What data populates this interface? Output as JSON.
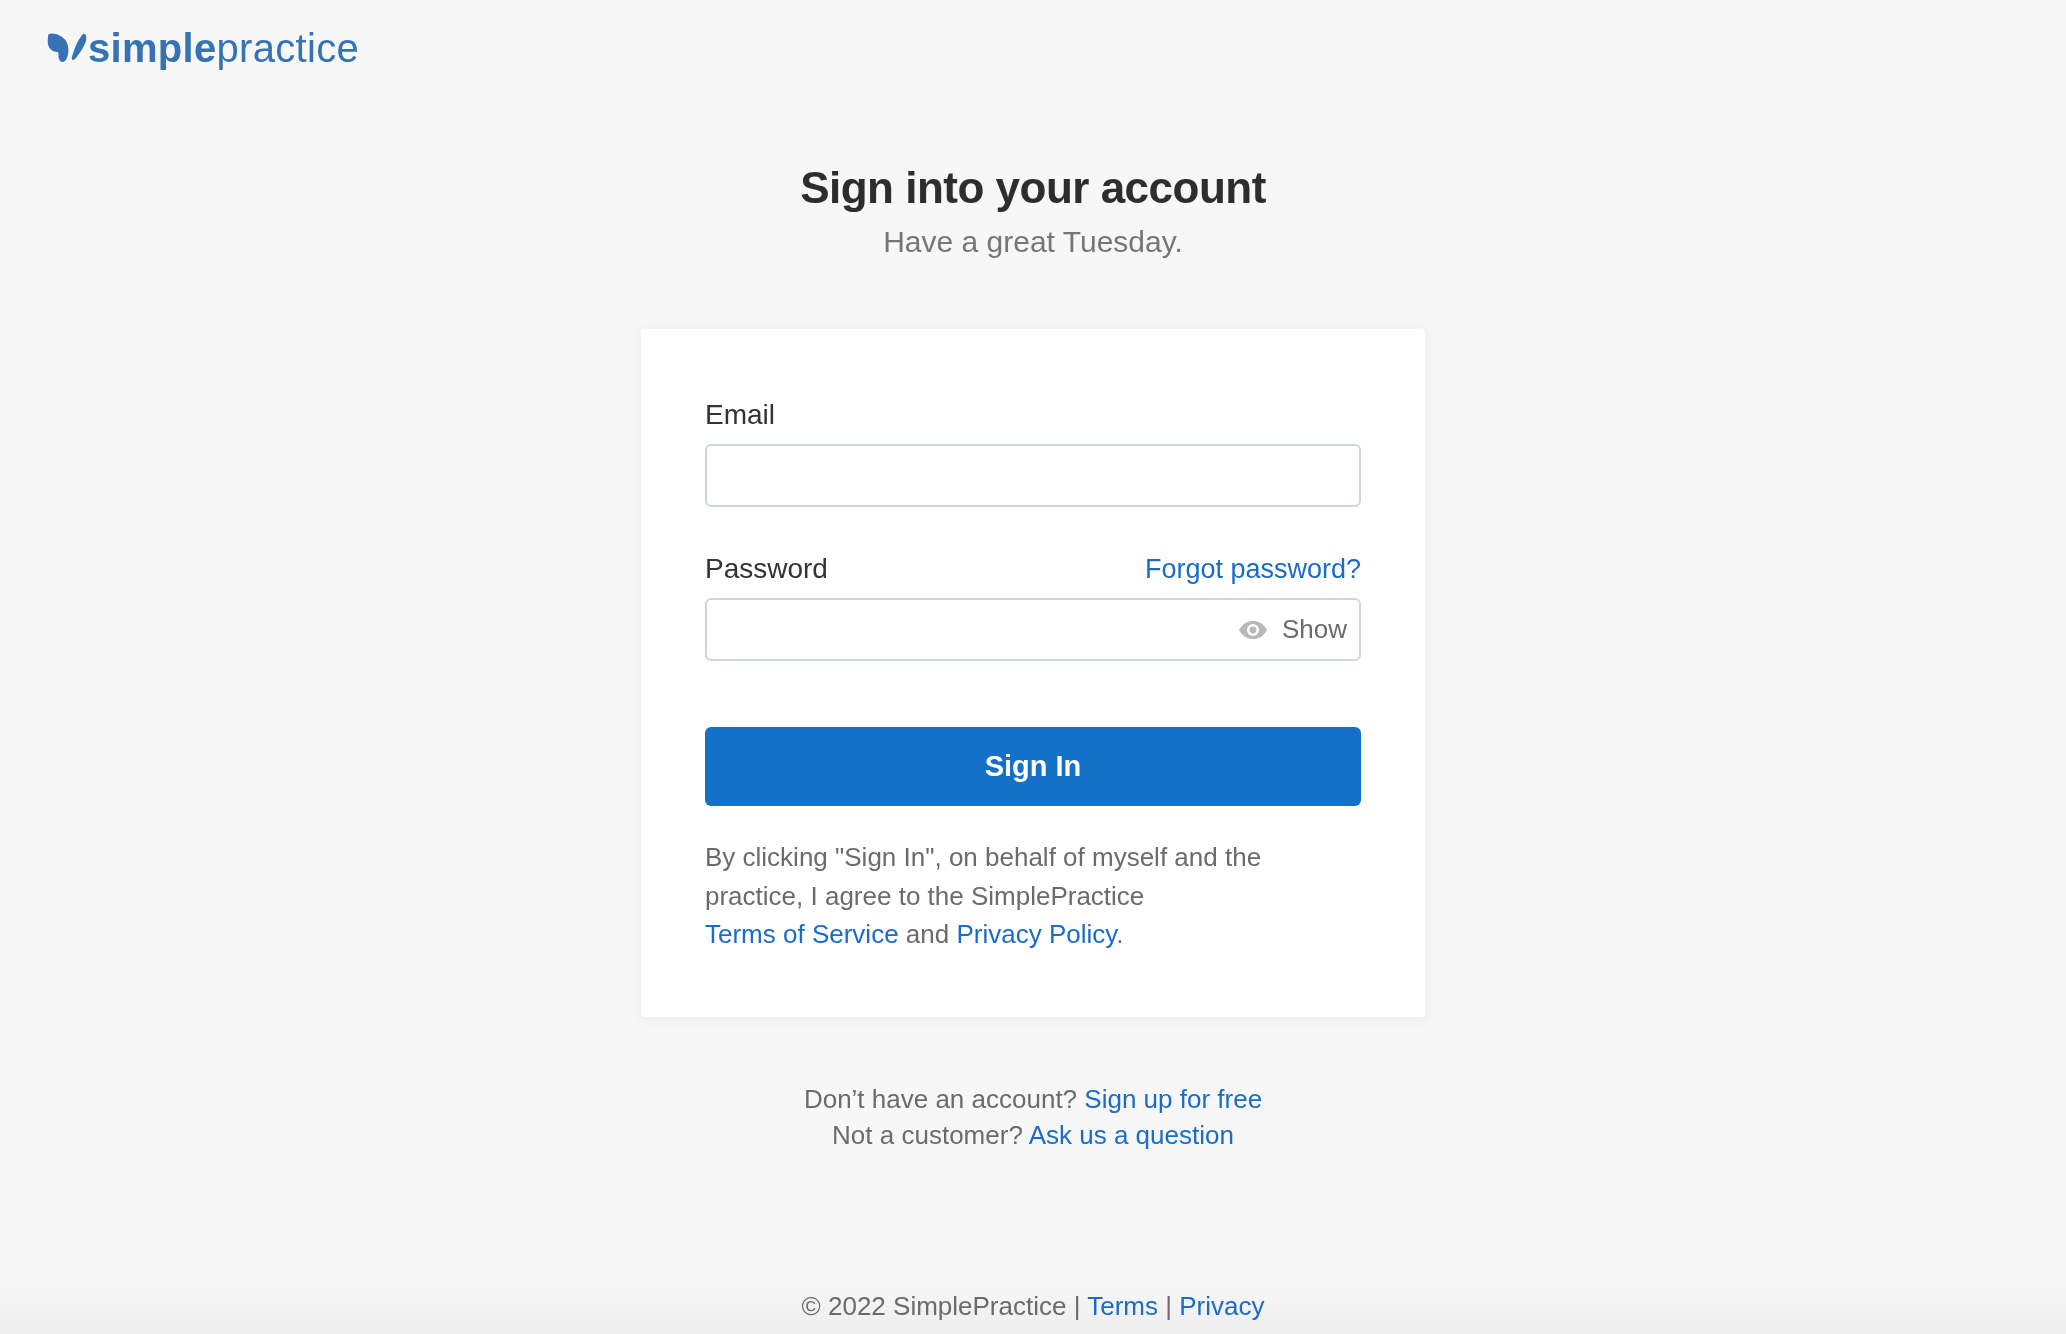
{
  "logo": {
    "text": "**simple**practice"
  },
  "heading": {
    "title": "Sign into your account",
    "subtitle": "Have a great Tuesday."
  },
  "form": {
    "fields": [
      {
        "kind": "email",
        "label": "Email"
      },
      {
        "kind": "password",
        "label": "Password",
        "link": "Forgot password?",
        "toggle": "Show"
      }
    ],
    "submit": "Sign In",
    "legal": [
      {
        "kind": "text",
        "text": "By clicking \"Sign In\", on behalf of myself and the practice, I agree to the SimplePractice "
      },
      {
        "kind": "link",
        "text": "Terms of Service"
      },
      {
        "kind": "text",
        "text": " and "
      },
      {
        "kind": "link",
        "text": "Privacy Policy"
      },
      {
        "kind": "text",
        "text": "."
      }
    ]
  },
  "prompts": [
    {
      "text": "Don’t have an account?",
      "link": "Sign up for free"
    },
    {
      "text": "Not a customer?",
      "link": "Ask us a question"
    }
  ],
  "footer": [
    {
      "kind": "text",
      "text": "© 2022 SimplePractice | "
    },
    {
      "kind": "link",
      "text": "Terms"
    },
    {
      "kind": "text",
      "text": " | "
    },
    {
      "kind": "link",
      "text": "Privacy"
    }
  ]
}
